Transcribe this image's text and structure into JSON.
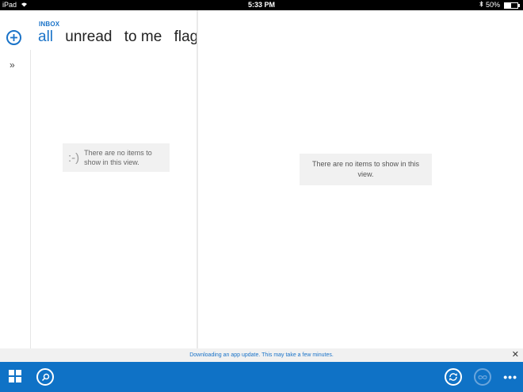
{
  "status_bar": {
    "device": "iPad",
    "time": "5:33 PM",
    "battery": "50%",
    "battery_level": 0.5
  },
  "header": {
    "folder": "INBOX",
    "pivots": [
      "all",
      "unread",
      "to me",
      "flagged"
    ]
  },
  "list_pane": {
    "empty_face": ":-)",
    "empty_message": "There are no items to show in this view."
  },
  "reading_pane": {
    "empty_message": "There are no items to show in this view."
  },
  "notification": {
    "text": "Downloading an app update. This may take a few minutes.",
    "close": "✕"
  },
  "app_bar": {
    "more": "•••"
  },
  "icons": {
    "compose": "plus-circle-icon",
    "expand": "double-chevron-right-icon",
    "apps": "four-squares-icon",
    "search": "search-icon",
    "sync": "sync-icon",
    "infinity": "infinity-icon"
  },
  "colors": {
    "accent": "#1a73c8",
    "app_bar": "#0f72c6",
    "notification_bg": "#f1f1f1"
  }
}
